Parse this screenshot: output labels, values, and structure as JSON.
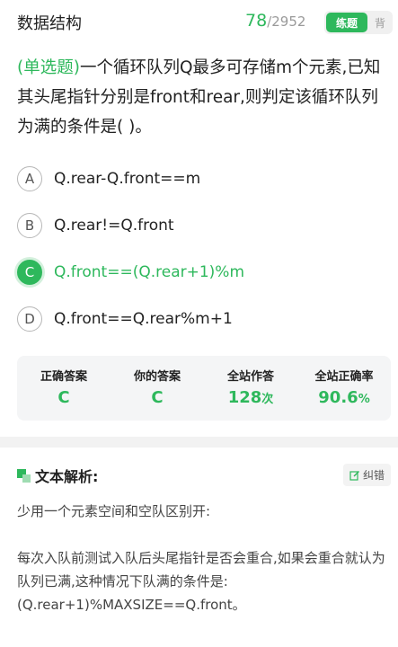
{
  "header": {
    "subject": "数据结构",
    "progress_current": "78",
    "progress_separator": "/",
    "progress_total": "2952",
    "mode_practice": "练题",
    "mode_recite": "背"
  },
  "question": {
    "type_label": "(单选题)",
    "text": "一个循环队列Q最多可存储m个元素,已知其头尾指针分别是front和rear,则判定该循环队列为满的条件是(        )。"
  },
  "options": [
    {
      "letter": "A",
      "text": "Q.rear-Q.front==m"
    },
    {
      "letter": "B",
      "text": "Q.rear!=Q.front"
    },
    {
      "letter": "C",
      "text": "Q.front==(Q.rear+1)%m"
    },
    {
      "letter": "D",
      "text": "Q.front==Q.rear%m+1"
    }
  ],
  "stats": {
    "correct_answer_label": "正确答案",
    "correct_answer_value": "C",
    "your_answer_label": "你的答案",
    "your_answer_value": "C",
    "attempts_label": "全站作答",
    "attempts_value": "128",
    "attempts_unit": "次",
    "accuracy_label": "全站正确率",
    "accuracy_value": "90.6",
    "accuracy_unit": "%"
  },
  "analysis": {
    "title": "文本解析:",
    "report_label": "纠错",
    "paragraph_1": "少用一个元素空间和空队区别开:",
    "paragraph_2": "每次入队前测试入队后头尾指针是否会重合,如果会重合就认为队列已满,这种情况下队满的条件是:(Q.rear+1)%MAXSIZE==Q.front。"
  },
  "colors": {
    "accent": "#2eb85c",
    "stats_bg": "#f4f5f6"
  }
}
